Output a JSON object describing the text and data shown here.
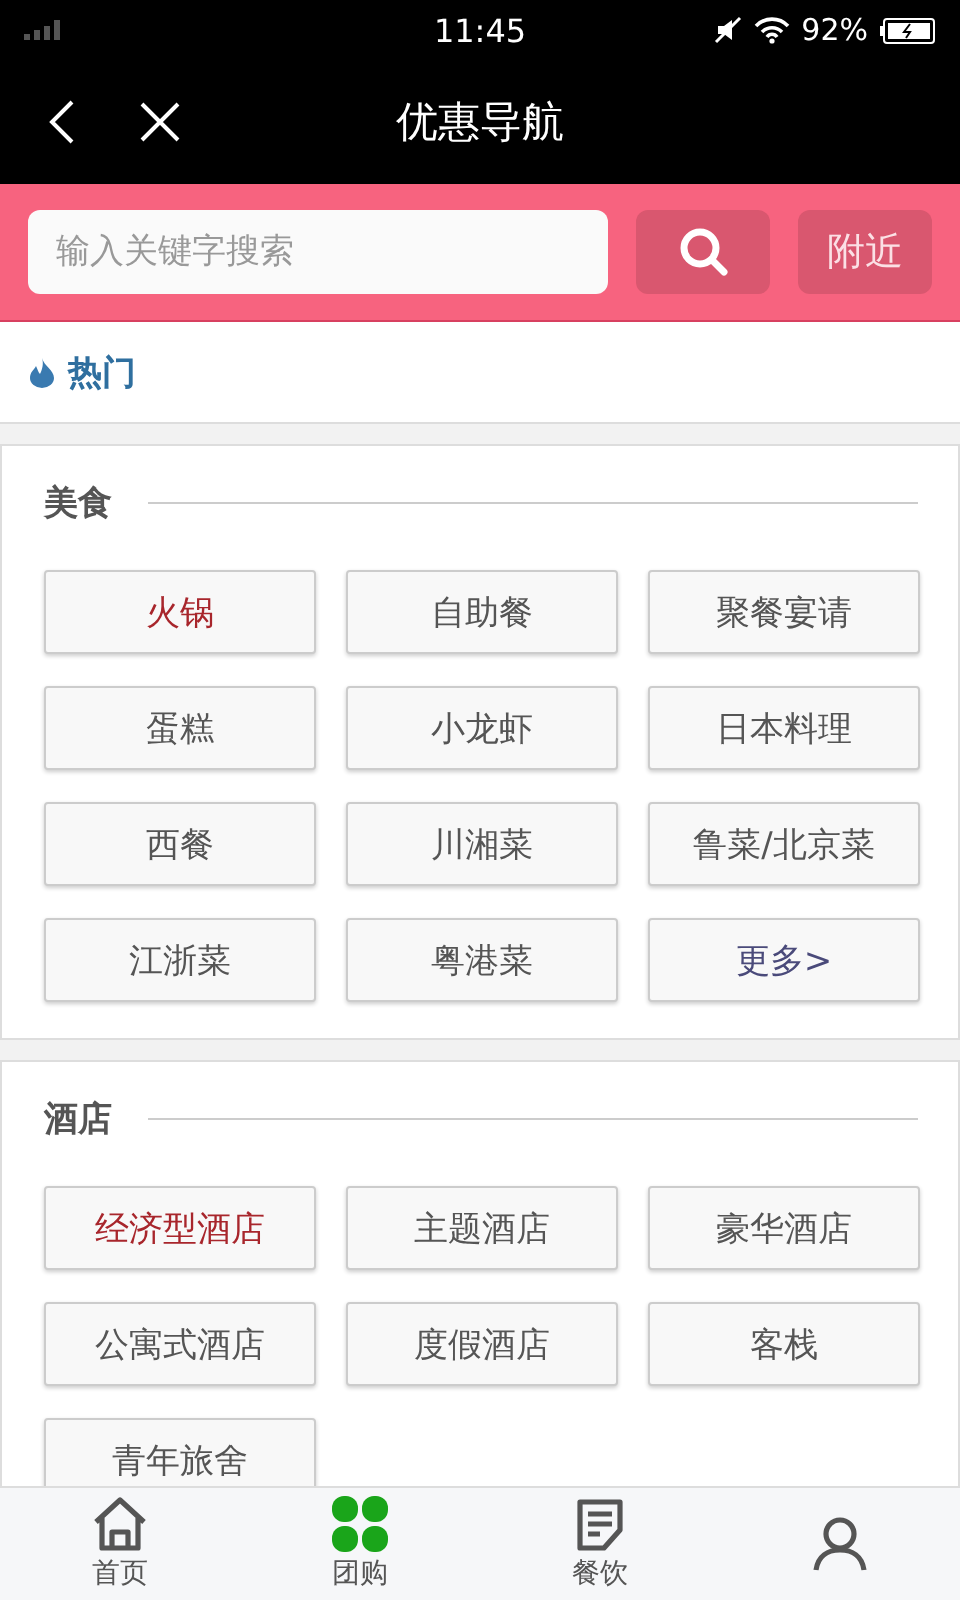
{
  "status_bar": {
    "time": "11:45",
    "battery": "92%"
  },
  "header": {
    "title": "优惠导航"
  },
  "search": {
    "placeholder": "输入关键字搜索",
    "nearby_button": "附近"
  },
  "hot": {
    "label": "热门"
  },
  "sections": [
    {
      "title": "美食",
      "items": [
        {
          "label": "火锅",
          "kind": "item",
          "highlighted": true
        },
        {
          "label": "自助餐",
          "kind": "item",
          "highlighted": false
        },
        {
          "label": "聚餐宴请",
          "kind": "item",
          "highlighted": false
        },
        {
          "label": "蛋糕",
          "kind": "item",
          "highlighted": false
        },
        {
          "label": "小龙虾",
          "kind": "item",
          "highlighted": false
        },
        {
          "label": "日本料理",
          "kind": "item",
          "highlighted": false
        },
        {
          "label": "西餐",
          "kind": "item",
          "highlighted": false
        },
        {
          "label": "川湘菜",
          "kind": "item",
          "highlighted": false
        },
        {
          "label": "鲁菜/北京菜",
          "kind": "item",
          "highlighted": false
        },
        {
          "label": "江浙菜",
          "kind": "item",
          "highlighted": false
        },
        {
          "label": "粤港菜",
          "kind": "item",
          "highlighted": false
        },
        {
          "label": "更多>",
          "kind": "more"
        }
      ]
    },
    {
      "title": "酒店",
      "items": [
        {
          "label": "经济型酒店",
          "kind": "item",
          "highlighted": true
        },
        {
          "label": "主题酒店",
          "kind": "item",
          "highlighted": false
        },
        {
          "label": "豪华酒店",
          "kind": "item",
          "highlighted": false
        },
        {
          "label": "公寓式酒店",
          "kind": "item",
          "highlighted": false
        },
        {
          "label": "度假酒店",
          "kind": "item",
          "highlighted": false
        },
        {
          "label": "客栈",
          "kind": "item",
          "highlighted": false
        },
        {
          "label": "青年旅舍",
          "kind": "item",
          "highlighted": false
        }
      ]
    }
  ],
  "tab_bar": [
    {
      "label": "首页",
      "kind": "home",
      "selected": false
    },
    {
      "label": "团购",
      "kind": "grid",
      "selected": true
    },
    {
      "label": "餐饮",
      "kind": "note",
      "selected": false
    },
    {
      "kind": "person",
      "selected": false
    }
  ]
}
